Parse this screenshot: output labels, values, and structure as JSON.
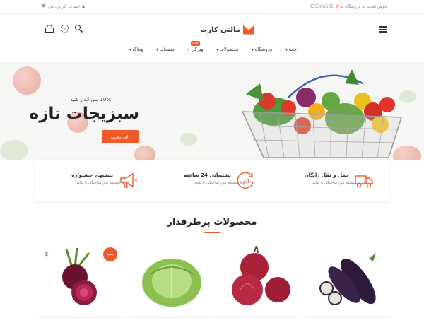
{
  "topbar": {
    "welcome": "خوش آمدید به فروشگاه ما",
    "phone": "035366605",
    "account": "حساب کاربری من"
  },
  "header": {
    "logo_text": "مالتی کارت",
    "icons": [
      "menu-icon",
      "search-icon",
      "gear-icon",
      "basket-icon"
    ]
  },
  "nav": {
    "items": [
      {
        "label": "خانه"
      },
      {
        "label": "فروشگاه"
      },
      {
        "label": "محصولات"
      },
      {
        "label": "ویژگی",
        "badge": "جدید"
      },
      {
        "label": "صفحات"
      },
      {
        "label": "وبلاگ"
      }
    ]
  },
  "hero": {
    "subtitle": "10% پس انداز کنید",
    "title": "سبزیجات تازه",
    "button": "الان بخرید"
  },
  "features": [
    {
      "title": "حمل و نقل رایگان",
      "desc": "لورم ایپسوم متن ساختگی با تولید",
      "icon": "truck-icon"
    },
    {
      "title": "پشتیبانی 24 ساعته",
      "desc": "لورم ایپسوم متن ساختگی با تولید",
      "icon": "support-24-icon"
    },
    {
      "title": "پیشنهاد جشنواره",
      "desc": "لورم ایپسوم متن ساختگی با تولید",
      "icon": "megaphone-icon"
    }
  ],
  "products": {
    "title": "محصولات پرطرفدار",
    "items": [
      {
        "name": "eggplant"
      },
      {
        "name": "onion"
      },
      {
        "name": "cabbage"
      },
      {
        "name": "beetroot",
        "badge": "جدید"
      }
    ]
  },
  "colors": {
    "accent": "#f0592a"
  }
}
